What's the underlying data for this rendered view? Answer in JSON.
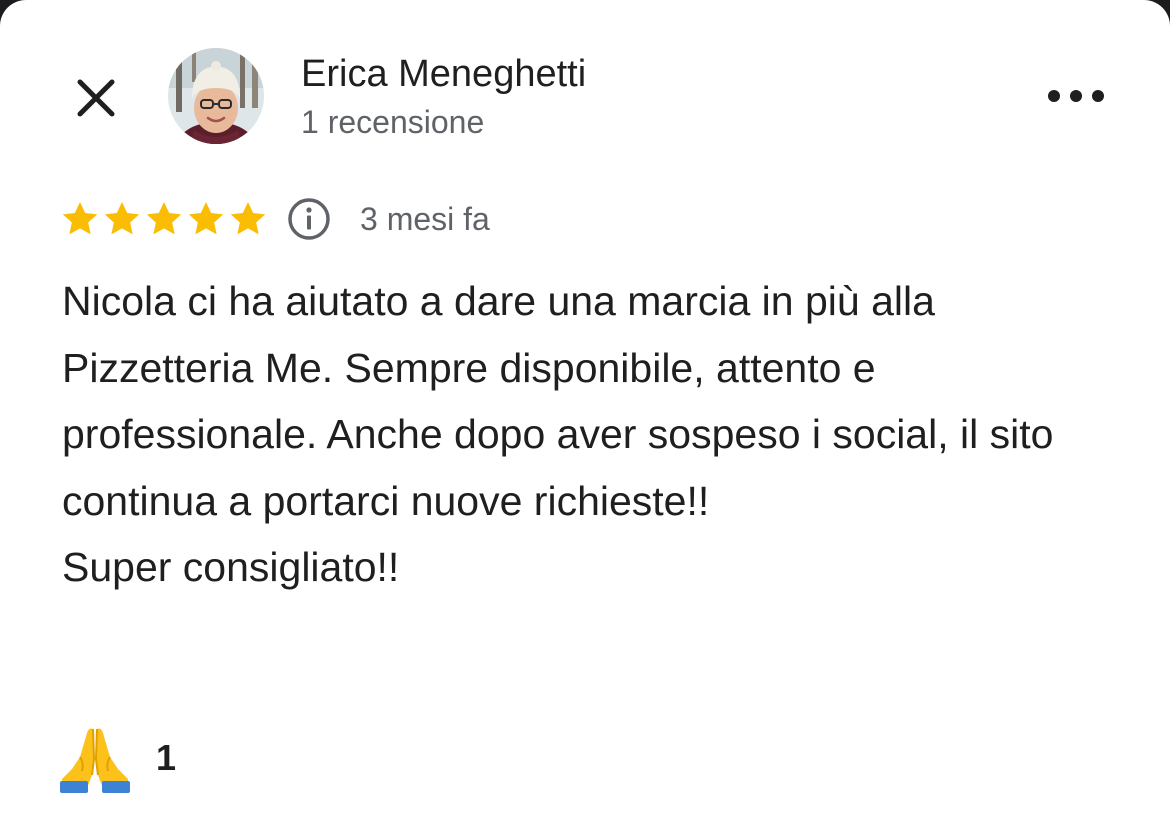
{
  "header": {
    "close_icon": "close-icon",
    "more_icon": "more-horizontal-icon",
    "author_name": "Erica Meneghetti",
    "author_meta": "1 recensione"
  },
  "review": {
    "rating": 5,
    "rating_max": 5,
    "star_color": "#fbbc04",
    "info_icon": "info-icon",
    "date": "3 mesi fa",
    "text": "Nicola ci ha aiutato a dare una marcia in più alla Pizzetteria Me. Sempre disponibile, attento e professionale. Anche dopo aver sospeso i social, il sito continua a portarci nuove richieste!!\nSuper consigliato!!"
  },
  "reactions": {
    "icon": "folded-hands-icon",
    "count": "1"
  }
}
